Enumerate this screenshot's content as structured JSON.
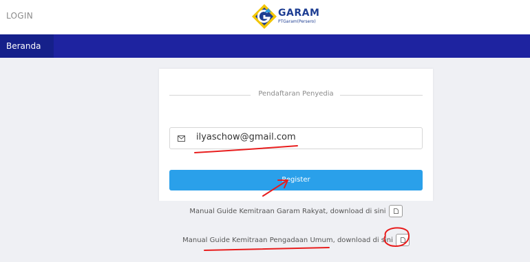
{
  "header": {
    "login_label": "LOGIN",
    "logo_text": "GARAM",
    "logo_subtext": "PTGaram(Persero)"
  },
  "nav": {
    "items": [
      {
        "label": "Beranda"
      }
    ]
  },
  "form": {
    "legend": "Pendaftaran Penyedia",
    "email_value": "ilyaschow@gmail.com",
    "register_label": "Register"
  },
  "manuals": [
    {
      "text": "Manual Guide Kemitraan Garam Rakyat, download di sini"
    },
    {
      "text": "Manual Guide Kemitraan Pengadaan Umum, download di sini"
    }
  ],
  "colors": {
    "navbar": "#1e23a0",
    "button": "#2aa0ea",
    "annotation": "#e81c1c"
  }
}
